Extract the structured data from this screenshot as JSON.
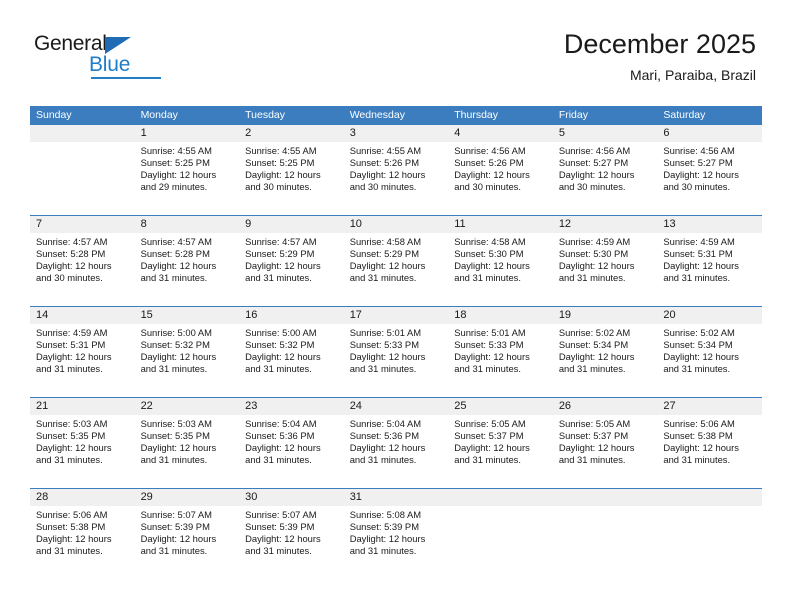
{
  "logo": {
    "word_one": "General",
    "word_two": "Blue",
    "triangle_color": "#1f6cb4",
    "blue_color": "#1f7ec9"
  },
  "header": {
    "title": "December 2025",
    "subtitle": "Mari, Paraiba, Brazil"
  },
  "theme": {
    "header_blue": "#3b7dbf",
    "daynum_band": "#f0f0f0",
    "text": "#1a1a1a"
  },
  "weekdays": [
    "Sunday",
    "Monday",
    "Tuesday",
    "Wednesday",
    "Thursday",
    "Friday",
    "Saturday"
  ],
  "weeks": [
    [
      {
        "day": "",
        "sunrise": "",
        "sunset": "",
        "daylight1": "",
        "daylight2": ""
      },
      {
        "day": "1",
        "sunrise": "Sunrise: 4:55 AM",
        "sunset": "Sunset: 5:25 PM",
        "daylight1": "Daylight: 12 hours",
        "daylight2": "and 29 minutes."
      },
      {
        "day": "2",
        "sunrise": "Sunrise: 4:55 AM",
        "sunset": "Sunset: 5:25 PM",
        "daylight1": "Daylight: 12 hours",
        "daylight2": "and 30 minutes."
      },
      {
        "day": "3",
        "sunrise": "Sunrise: 4:55 AM",
        "sunset": "Sunset: 5:26 PM",
        "daylight1": "Daylight: 12 hours",
        "daylight2": "and 30 minutes."
      },
      {
        "day": "4",
        "sunrise": "Sunrise: 4:56 AM",
        "sunset": "Sunset: 5:26 PM",
        "daylight1": "Daylight: 12 hours",
        "daylight2": "and 30 minutes."
      },
      {
        "day": "5",
        "sunrise": "Sunrise: 4:56 AM",
        "sunset": "Sunset: 5:27 PM",
        "daylight1": "Daylight: 12 hours",
        "daylight2": "and 30 minutes."
      },
      {
        "day": "6",
        "sunrise": "Sunrise: 4:56 AM",
        "sunset": "Sunset: 5:27 PM",
        "daylight1": "Daylight: 12 hours",
        "daylight2": "and 30 minutes."
      }
    ],
    [
      {
        "day": "7",
        "sunrise": "Sunrise: 4:57 AM",
        "sunset": "Sunset: 5:28 PM",
        "daylight1": "Daylight: 12 hours",
        "daylight2": "and 30 minutes."
      },
      {
        "day": "8",
        "sunrise": "Sunrise: 4:57 AM",
        "sunset": "Sunset: 5:28 PM",
        "daylight1": "Daylight: 12 hours",
        "daylight2": "and 31 minutes."
      },
      {
        "day": "9",
        "sunrise": "Sunrise: 4:57 AM",
        "sunset": "Sunset: 5:29 PM",
        "daylight1": "Daylight: 12 hours",
        "daylight2": "and 31 minutes."
      },
      {
        "day": "10",
        "sunrise": "Sunrise: 4:58 AM",
        "sunset": "Sunset: 5:29 PM",
        "daylight1": "Daylight: 12 hours",
        "daylight2": "and 31 minutes."
      },
      {
        "day": "11",
        "sunrise": "Sunrise: 4:58 AM",
        "sunset": "Sunset: 5:30 PM",
        "daylight1": "Daylight: 12 hours",
        "daylight2": "and 31 minutes."
      },
      {
        "day": "12",
        "sunrise": "Sunrise: 4:59 AM",
        "sunset": "Sunset: 5:30 PM",
        "daylight1": "Daylight: 12 hours",
        "daylight2": "and 31 minutes."
      },
      {
        "day": "13",
        "sunrise": "Sunrise: 4:59 AM",
        "sunset": "Sunset: 5:31 PM",
        "daylight1": "Daylight: 12 hours",
        "daylight2": "and 31 minutes."
      }
    ],
    [
      {
        "day": "14",
        "sunrise": "Sunrise: 4:59 AM",
        "sunset": "Sunset: 5:31 PM",
        "daylight1": "Daylight: 12 hours",
        "daylight2": "and 31 minutes."
      },
      {
        "day": "15",
        "sunrise": "Sunrise: 5:00 AM",
        "sunset": "Sunset: 5:32 PM",
        "daylight1": "Daylight: 12 hours",
        "daylight2": "and 31 minutes."
      },
      {
        "day": "16",
        "sunrise": "Sunrise: 5:00 AM",
        "sunset": "Sunset: 5:32 PM",
        "daylight1": "Daylight: 12 hours",
        "daylight2": "and 31 minutes."
      },
      {
        "day": "17",
        "sunrise": "Sunrise: 5:01 AM",
        "sunset": "Sunset: 5:33 PM",
        "daylight1": "Daylight: 12 hours",
        "daylight2": "and 31 minutes."
      },
      {
        "day": "18",
        "sunrise": "Sunrise: 5:01 AM",
        "sunset": "Sunset: 5:33 PM",
        "daylight1": "Daylight: 12 hours",
        "daylight2": "and 31 minutes."
      },
      {
        "day": "19",
        "sunrise": "Sunrise: 5:02 AM",
        "sunset": "Sunset: 5:34 PM",
        "daylight1": "Daylight: 12 hours",
        "daylight2": "and 31 minutes."
      },
      {
        "day": "20",
        "sunrise": "Sunrise: 5:02 AM",
        "sunset": "Sunset: 5:34 PM",
        "daylight1": "Daylight: 12 hours",
        "daylight2": "and 31 minutes."
      }
    ],
    [
      {
        "day": "21",
        "sunrise": "Sunrise: 5:03 AM",
        "sunset": "Sunset: 5:35 PM",
        "daylight1": "Daylight: 12 hours",
        "daylight2": "and 31 minutes."
      },
      {
        "day": "22",
        "sunrise": "Sunrise: 5:03 AM",
        "sunset": "Sunset: 5:35 PM",
        "daylight1": "Daylight: 12 hours",
        "daylight2": "and 31 minutes."
      },
      {
        "day": "23",
        "sunrise": "Sunrise: 5:04 AM",
        "sunset": "Sunset: 5:36 PM",
        "daylight1": "Daylight: 12 hours",
        "daylight2": "and 31 minutes."
      },
      {
        "day": "24",
        "sunrise": "Sunrise: 5:04 AM",
        "sunset": "Sunset: 5:36 PM",
        "daylight1": "Daylight: 12 hours",
        "daylight2": "and 31 minutes."
      },
      {
        "day": "25",
        "sunrise": "Sunrise: 5:05 AM",
        "sunset": "Sunset: 5:37 PM",
        "daylight1": "Daylight: 12 hours",
        "daylight2": "and 31 minutes."
      },
      {
        "day": "26",
        "sunrise": "Sunrise: 5:05 AM",
        "sunset": "Sunset: 5:37 PM",
        "daylight1": "Daylight: 12 hours",
        "daylight2": "and 31 minutes."
      },
      {
        "day": "27",
        "sunrise": "Sunrise: 5:06 AM",
        "sunset": "Sunset: 5:38 PM",
        "daylight1": "Daylight: 12 hours",
        "daylight2": "and 31 minutes."
      }
    ],
    [
      {
        "day": "28",
        "sunrise": "Sunrise: 5:06 AM",
        "sunset": "Sunset: 5:38 PM",
        "daylight1": "Daylight: 12 hours",
        "daylight2": "and 31 minutes."
      },
      {
        "day": "29",
        "sunrise": "Sunrise: 5:07 AM",
        "sunset": "Sunset: 5:39 PM",
        "daylight1": "Daylight: 12 hours",
        "daylight2": "and 31 minutes."
      },
      {
        "day": "30",
        "sunrise": "Sunrise: 5:07 AM",
        "sunset": "Sunset: 5:39 PM",
        "daylight1": "Daylight: 12 hours",
        "daylight2": "and 31 minutes."
      },
      {
        "day": "31",
        "sunrise": "Sunrise: 5:08 AM",
        "sunset": "Sunset: 5:39 PM",
        "daylight1": "Daylight: 12 hours",
        "daylight2": "and 31 minutes."
      },
      {
        "day": "",
        "sunrise": "",
        "sunset": "",
        "daylight1": "",
        "daylight2": ""
      },
      {
        "day": "",
        "sunrise": "",
        "sunset": "",
        "daylight1": "",
        "daylight2": ""
      },
      {
        "day": "",
        "sunrise": "",
        "sunset": "",
        "daylight1": "",
        "daylight2": ""
      }
    ]
  ]
}
